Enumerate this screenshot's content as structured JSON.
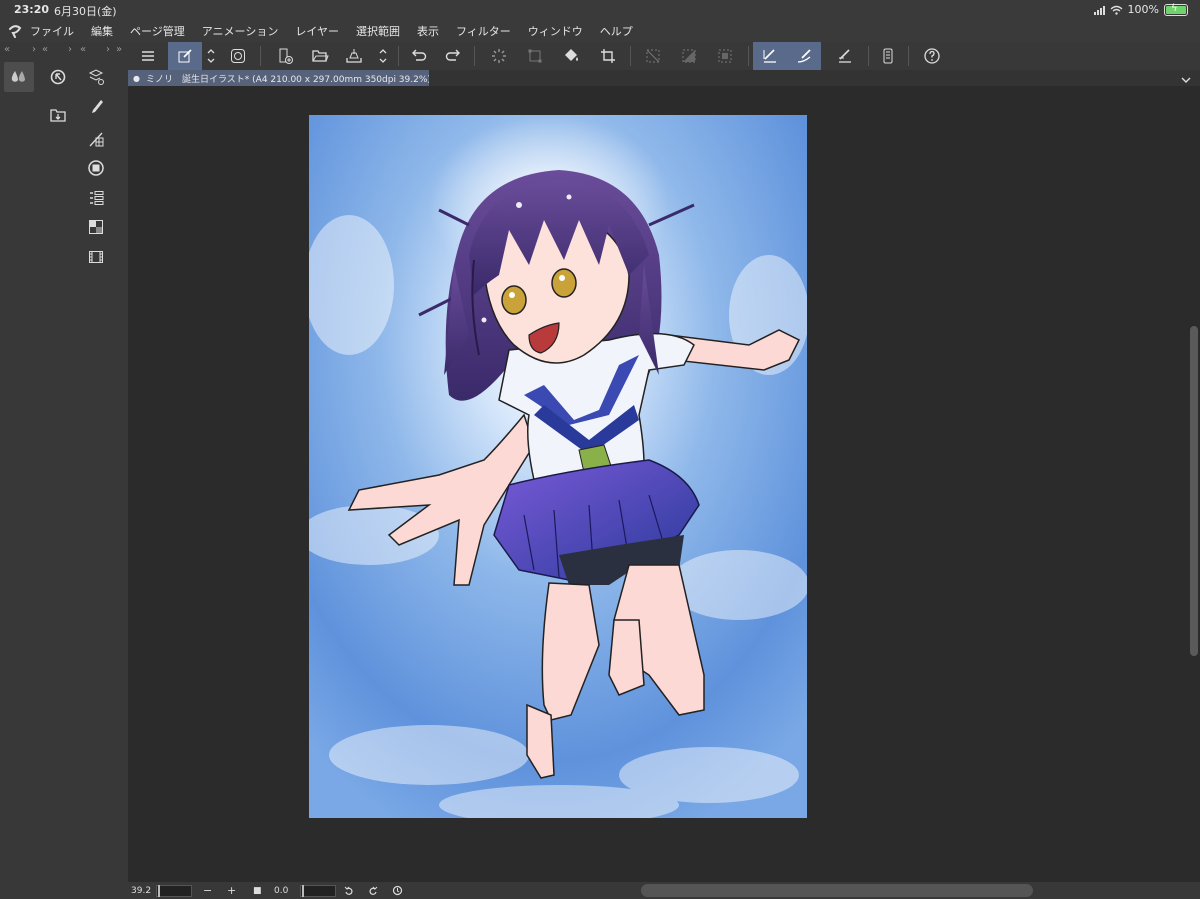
{
  "status_bar": {
    "time": "23:20",
    "date": "6月30日(金)",
    "battery": "100%"
  },
  "menu": {
    "items": [
      "ファイル",
      "編集",
      "ページ管理",
      "アニメーション",
      "レイヤー",
      "選択範囲",
      "表示",
      "フィルター",
      "ウィンドウ",
      "ヘルプ"
    ]
  },
  "left_panel": {
    "tools": [
      "drop-tool-icon",
      "navigator-icon",
      "layer-properties-icon",
      "brush-icon",
      "ruler-icon",
      "color-circle-icon",
      "layer-list-icon",
      "material-icon",
      "timeline-icon",
      "import-folder-icon"
    ]
  },
  "tab": {
    "title": "ミノリ　誕生日イラスト* (A4 210.00 x 297.00mm 350dpi 39.2%)"
  },
  "bottom_bar": {
    "zoom": "39.2",
    "rotation": "0.0"
  },
  "colors": {
    "active_tool": "#5a6a8a",
    "tab_active": "#56617a",
    "panel_bg": "#383838",
    "canvas_bg": "#2b2b2b"
  }
}
